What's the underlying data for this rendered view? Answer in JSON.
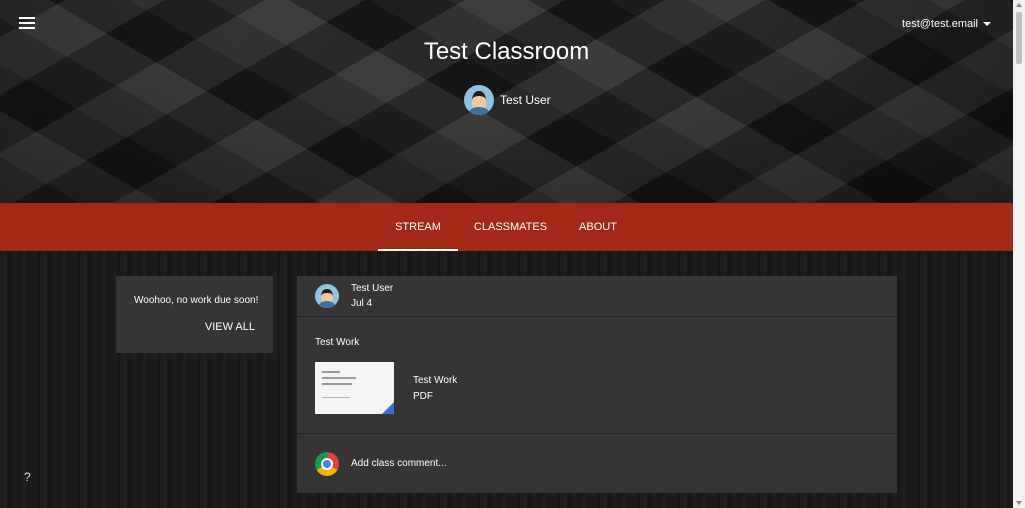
{
  "header": {
    "class_title": "Test Classroom",
    "teacher_name": "Test User",
    "account_email": "test@test.email",
    "menu_icon": "hamburger-menu-icon"
  },
  "nav": {
    "tabs": [
      {
        "label": "STREAM",
        "active": true
      },
      {
        "label": "CLASSMATES",
        "active": false
      },
      {
        "label": "ABOUT",
        "active": false
      }
    ],
    "accent_color": "#a42817"
  },
  "upcoming": {
    "message": "Woohoo, no work due soon!",
    "view_all_label": "VIEW ALL"
  },
  "post": {
    "author": "Test User",
    "date": "Jul 4",
    "text": "Test Work",
    "attachment": {
      "title": "Test Work",
      "type": "PDF"
    },
    "comment_placeholder": "Add class comment..."
  },
  "help": {
    "label": "?"
  }
}
